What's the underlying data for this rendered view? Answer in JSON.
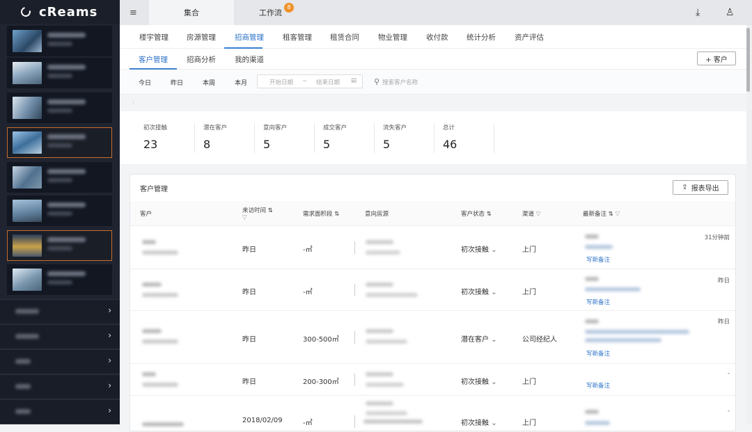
{
  "app": {
    "logo": "cReams"
  },
  "topbar": {
    "tabs": [
      {
        "label": "集合"
      },
      {
        "label": "工作流",
        "badge": "8"
      }
    ]
  },
  "nav1": {
    "items": [
      "楼宇管理",
      "房源管理",
      "招商管理",
      "租客管理",
      "租赁合同",
      "物业管理",
      "收付款",
      "统计分析",
      "资产评估"
    ],
    "active": "招商管理"
  },
  "nav2": {
    "items": [
      "客户管理",
      "招商分析",
      "我的渠道"
    ],
    "active": "客户管理",
    "add_button": "+ 客户"
  },
  "filter": {
    "quick": [
      "今日",
      "昨日",
      "本周",
      "本月"
    ],
    "start_placeholder": "开始日期",
    "tilde": "~",
    "end_placeholder": "结束日期",
    "search_placeholder": "搜索客户名称"
  },
  "stats": [
    {
      "label": "初次接触",
      "value": "23"
    },
    {
      "label": "潜在客户",
      "value": "8"
    },
    {
      "label": "意向客户",
      "value": "5"
    },
    {
      "label": "成交客户",
      "value": "5"
    },
    {
      "label": "流失客户",
      "value": "5"
    },
    {
      "label": "总计",
      "value": "46"
    }
  ],
  "panel": {
    "title": "客户管理",
    "export_button": "报表导出",
    "columns": [
      "客户",
      "来访时间",
      "需求面积段",
      "意向房源",
      "客户状态",
      "渠道",
      "最新备注"
    ],
    "rows": [
      {
        "visit": "昨日",
        "area": "-㎡",
        "status": "初次接触",
        "channel": "上门",
        "note_link": "写新备注",
        "time": "31分钟前"
      },
      {
        "visit": "昨日",
        "area": "-㎡",
        "status": "初次接触",
        "channel": "上门",
        "note_link": "写新备注",
        "time": "昨日"
      },
      {
        "visit": "昨日",
        "area": "300-500㎡",
        "status": "潜在客户",
        "channel": "公司经纪人",
        "note_link": "写新备注",
        "time": "昨日"
      },
      {
        "visit": "昨日",
        "area": "200-300㎡",
        "status": "初次接触",
        "channel": "上门",
        "note_link": "写新备注",
        "time": "-"
      },
      {
        "visit": "2018/02/09",
        "area": "-㎡",
        "status": "初次接触",
        "channel": "上门",
        "note_link": "",
        "time": "-"
      }
    ]
  },
  "sidebar": {
    "group_count": 5
  },
  "colors": {
    "accent": "#3a80d2",
    "sidebar_bg": "#1f2430",
    "selected_border": "#c96f2a",
    "badge": "#f0932b"
  }
}
